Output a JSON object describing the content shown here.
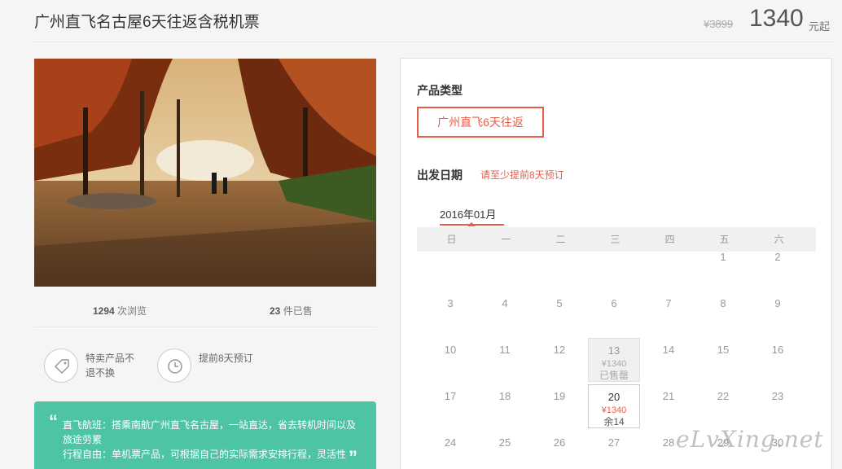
{
  "header": {
    "title": "广州直飞名古屋6天往返含税机票",
    "original_price": "¥3899",
    "price": "1340",
    "price_unit": "元起"
  },
  "stats": {
    "views_count": "1294",
    "views_label": " 次浏览",
    "sold_count": "23",
    "sold_label": " 件已售"
  },
  "features": [
    {
      "icon": "tag-icon",
      "text": "特卖产品不退不换"
    },
    {
      "icon": "clock-icon",
      "text": "提前8天预订"
    }
  ],
  "notice": {
    "open_quote": "“",
    "close_quote": "”",
    "line1": "直飞航班：搭乘南航广州直飞名古屋，一站直达，省去转机时间以及旅途劳累",
    "line2": "行程自由：单机票产品，可根据自己的实际需求安排行程，灵活性"
  },
  "booking": {
    "product_type_label": "产品类型",
    "product_option": "广州直飞6天往返",
    "departure_label": "出发日期",
    "departure_hint": "请至少提前8天预订",
    "month": "2016年01月",
    "weekdays": [
      "日",
      "一",
      "二",
      "三",
      "四",
      "五",
      "六"
    ],
    "days": [
      {
        "day": "1"
      },
      {
        "day": "2"
      },
      {
        "day": "3"
      },
      {
        "day": "4"
      },
      {
        "day": "5"
      },
      {
        "day": "6"
      },
      {
        "day": "7"
      },
      {
        "day": "8"
      },
      {
        "day": "9"
      },
      {
        "day": "10"
      },
      {
        "day": "11"
      },
      {
        "day": "12"
      },
      {
        "day": "13",
        "price": "¥1340",
        "status": "已售罄"
      },
      {
        "day": "14"
      },
      {
        "day": "15"
      },
      {
        "day": "16"
      },
      {
        "day": "17"
      },
      {
        "day": "18"
      },
      {
        "day": "19"
      },
      {
        "day": "20",
        "price": "¥1340",
        "status": "余14"
      },
      {
        "day": "21"
      },
      {
        "day": "22"
      },
      {
        "day": "23"
      },
      {
        "day": "24"
      },
      {
        "day": "25"
      },
      {
        "day": "26"
      },
      {
        "day": "27"
      },
      {
        "day": "28"
      },
      {
        "day": "29"
      },
      {
        "day": "30"
      }
    ]
  },
  "watermark": "eLvXing.net",
  "colors": {
    "accent": "#e85c4a",
    "notice_bg": "#4dc4a6"
  }
}
